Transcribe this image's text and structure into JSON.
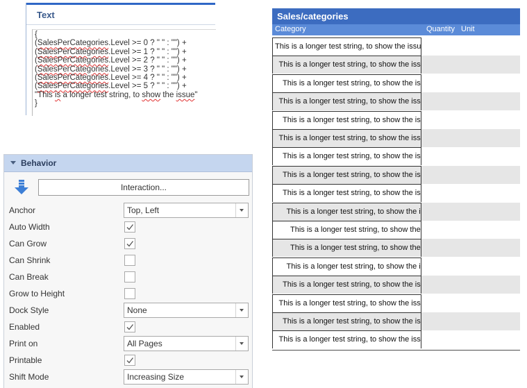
{
  "text_panel": {
    "title": "Text",
    "lines": [
      "{",
      "(SalesPerCategories.Level >= 0 ? \" \" : \"\") +",
      "(SalesPerCategories.Level >= 1 ? \" \" : \"\") +",
      "(SalesPerCategories.Level >= 2 ? \" \" : \"\") +",
      "(SalesPerCategories.Level >= 3 ? \" \" : \"\") +",
      "(SalesPerCategories.Level >= 4 ? \" \" : \"\") +",
      "(SalesPerCategories.Level >= 5 ? \" \" : \"\") +",
      "\"This is a longer test string, to show the issue\"",
      "}"
    ]
  },
  "behavior": {
    "title": "Behavior",
    "interaction_label": "Interaction...",
    "properties": [
      {
        "label": "Anchor",
        "type": "combo",
        "value": "Top, Left"
      },
      {
        "label": "Auto Width",
        "type": "check",
        "checked": true
      },
      {
        "label": "Can Grow",
        "type": "check",
        "checked": true
      },
      {
        "label": "Can Shrink",
        "type": "check",
        "checked": false
      },
      {
        "label": "Can Break",
        "type": "check",
        "checked": false
      },
      {
        "label": "Grow to Height",
        "type": "check",
        "checked": false
      },
      {
        "label": "Dock Style",
        "type": "combo",
        "value": "None"
      },
      {
        "label": "Enabled",
        "type": "check",
        "checked": true
      },
      {
        "label": "Print on",
        "type": "combo",
        "value": "All Pages"
      },
      {
        "label": "Printable",
        "type": "check",
        "checked": true
      },
      {
        "label": "Shift Mode",
        "type": "combo",
        "value": "Increasing Size"
      }
    ]
  },
  "report": {
    "title": "Sales/categories",
    "columns": {
      "category": "Category",
      "quantity": "Quantity",
      "unit": "Unit"
    },
    "rows": [
      {
        "text": "This is a longer test string, to show the issue",
        "indent_level": 0
      },
      {
        "text": "This is a longer test string, to show the issue",
        "indent_level": 1
      },
      {
        "text": "This is a longer test string, to show the issue",
        "indent_level": 2
      },
      {
        "text": "This is a longer test string, to show the issue",
        "indent_level": 1
      },
      {
        "text": "This is a longer test string, to show the issue",
        "indent_level": 2
      },
      {
        "text": "This is a longer test string, to show the issue",
        "indent_level": 1
      },
      {
        "text": "This is a longer test string, to show the issue",
        "indent_level": 2
      },
      {
        "text": "This is a longer test string, to show the issue",
        "indent_level": 2
      },
      {
        "text": "This is a longer test string, to show the issue",
        "indent_level": 2
      },
      {
        "text": "This is a longer test string, to show the issue",
        "indent_level": 3
      },
      {
        "text": "This is a longer test string, to show the issue",
        "indent_level": 4
      },
      {
        "text": "This is a longer test string, to show the issue",
        "indent_level": 4
      },
      {
        "text": "This is a longer test string, to show the issue",
        "indent_level": 3
      },
      {
        "text": "This is a longer test string, to show the issue",
        "indent_level": 2
      },
      {
        "text": "This is a longer test string, to show the issue",
        "indent_level": 1
      },
      {
        "text": "This is a longer test string, to show the issue",
        "indent_level": 2
      },
      {
        "text": "This is a longer test string, to show the issue",
        "indent_level": 1
      }
    ]
  },
  "icons": {
    "sort_icon": "arrow-down-icon",
    "check_icon": "checkmark-icon",
    "dropdown_icon": "chevron-down-icon",
    "collapse_icon": "triangle-down-icon"
  },
  "colors": {
    "report_title_bg": "#3c6cc0",
    "report_header_bg": "#5b8bd8",
    "behavior_header_bg": "#c5d6ef",
    "accent_blue": "#2f67c6"
  }
}
